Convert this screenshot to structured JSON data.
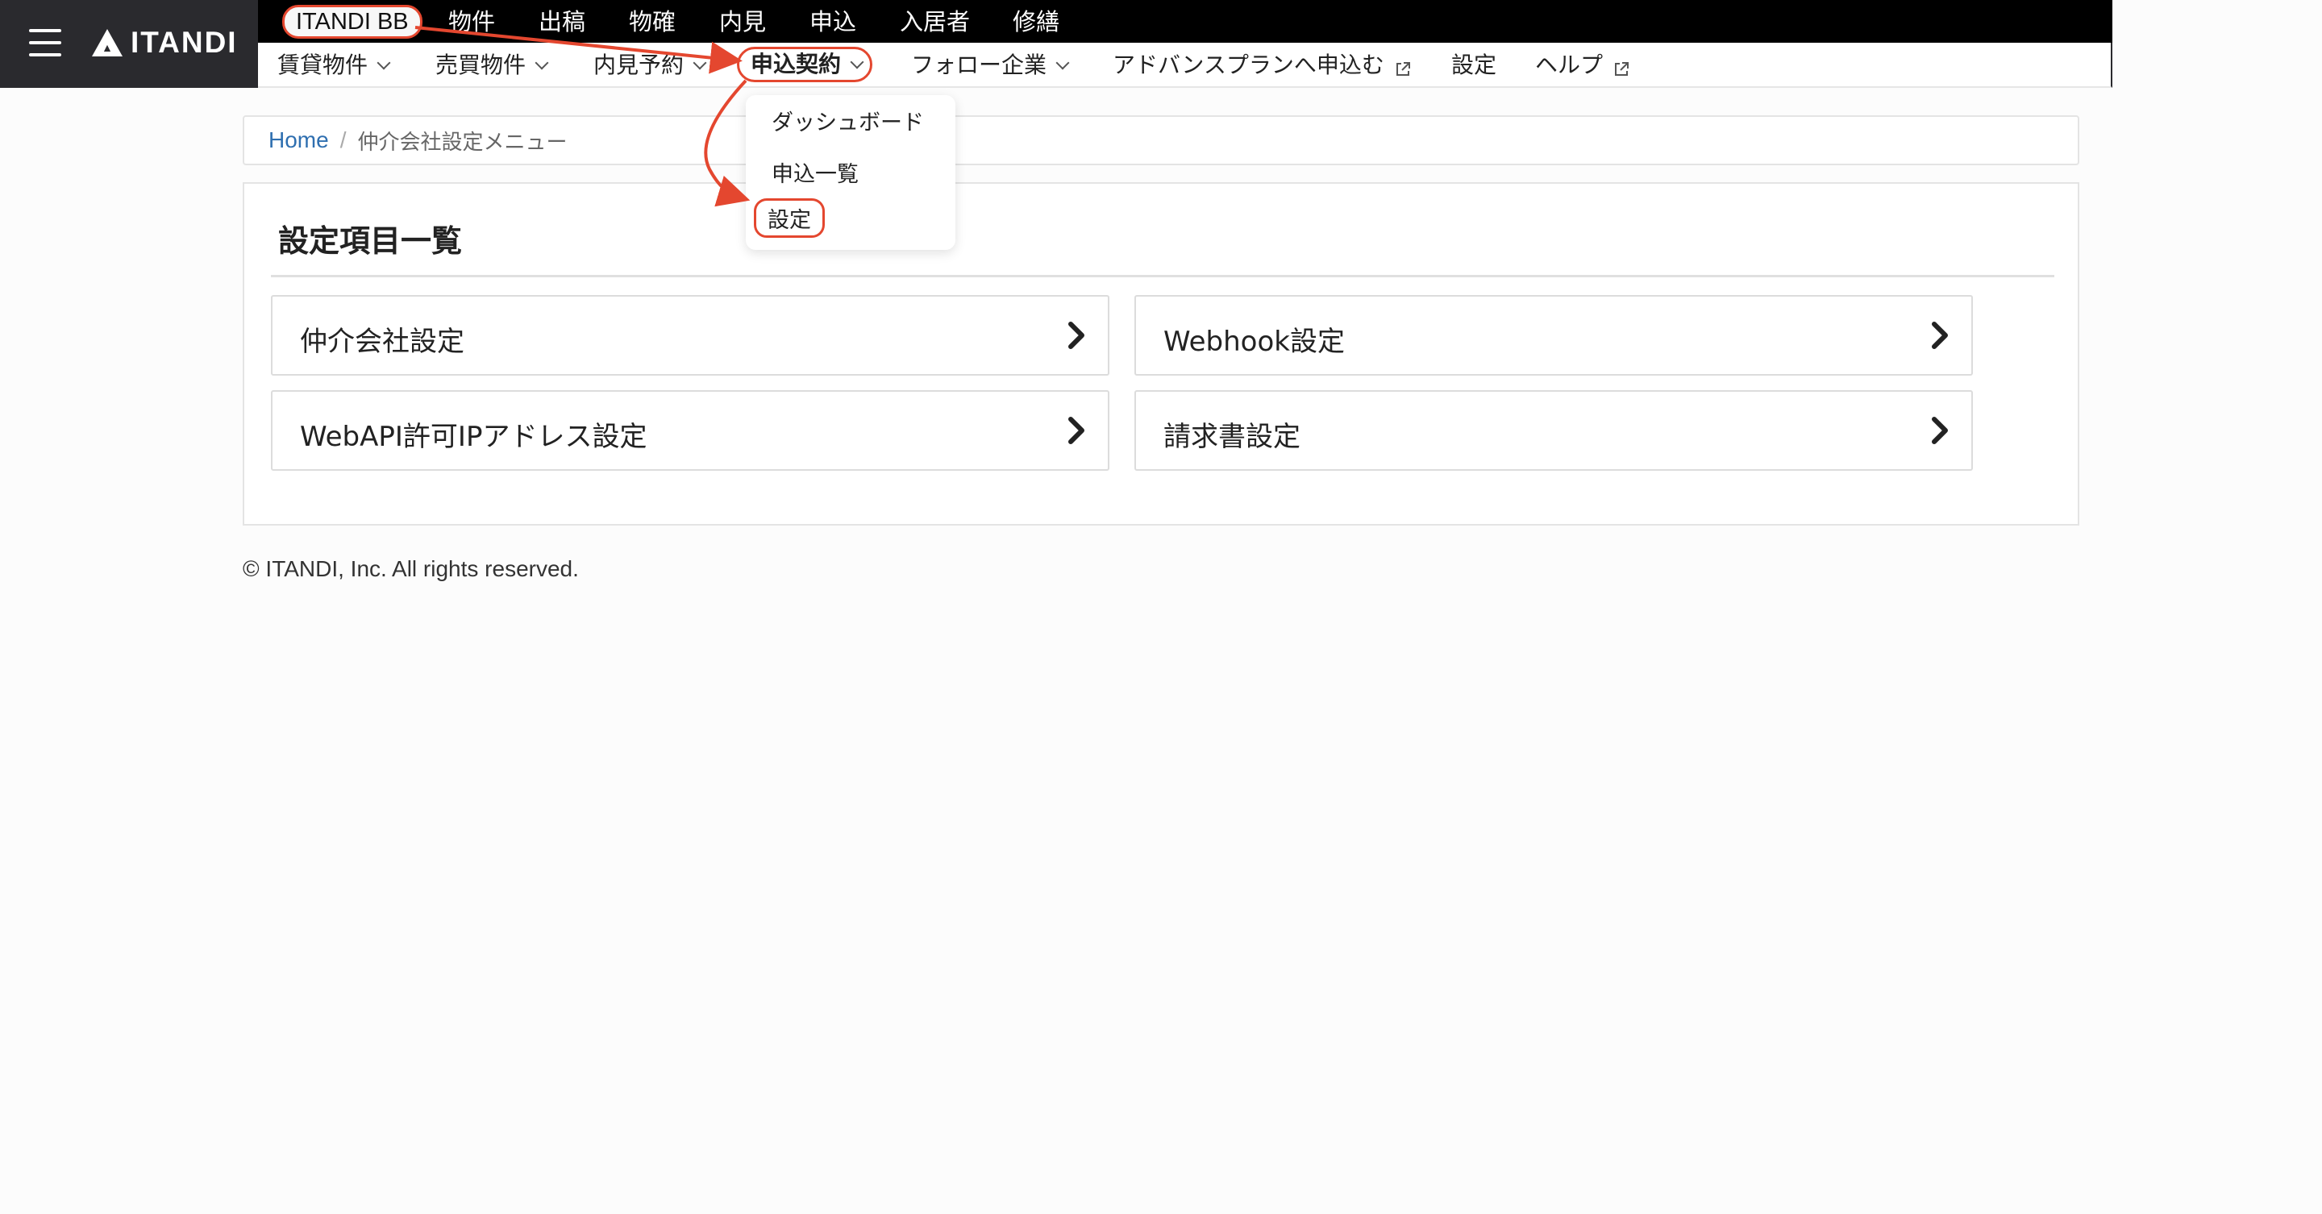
{
  "brand": {
    "name": "ITANDI"
  },
  "topnav": {
    "items": [
      {
        "label": "ITANDI BB"
      },
      {
        "label": "物件"
      },
      {
        "label": "出稿"
      },
      {
        "label": "物確"
      },
      {
        "label": "内見"
      },
      {
        "label": "申込"
      },
      {
        "label": "入居者"
      },
      {
        "label": "修繕"
      }
    ]
  },
  "subnav": {
    "items": [
      {
        "label": "賃貸物件"
      },
      {
        "label": "売買物件"
      },
      {
        "label": "内見予約"
      },
      {
        "label": "申込契約"
      },
      {
        "label": "フォロー企業"
      },
      {
        "label": "アドバンスプランへ申込む"
      },
      {
        "label": "設定"
      },
      {
        "label": "ヘルプ"
      }
    ]
  },
  "dropdown": {
    "items": [
      {
        "label": "ダッシュボード"
      },
      {
        "label": "申込一覧"
      },
      {
        "label": "設定"
      }
    ]
  },
  "breadcrumb": {
    "home": "Home",
    "separator": "/",
    "current": "仲介会社設定メニュー"
  },
  "main": {
    "title": "設定項目一覧",
    "cards": [
      {
        "label": "仲介会社設定"
      },
      {
        "label": "Webhook設定"
      },
      {
        "label": "WebAPI許可IPアドレス設定"
      },
      {
        "label": "請求書設定"
      }
    ]
  },
  "footer": {
    "text": "© ITANDI, Inc. All rights reserved."
  },
  "colors": {
    "highlight": "#e4472f",
    "link": "#2f6fb0",
    "brand_bg": "#2a2a2e"
  }
}
